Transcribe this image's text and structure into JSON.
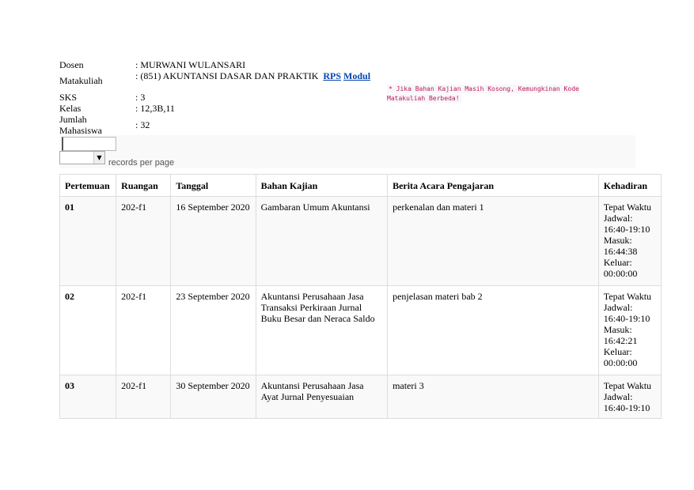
{
  "info": {
    "dosen_label": "Dosen",
    "dosen_value": ": MURWANI WULANSARI",
    "matakuliah_label": "Matakuliah",
    "matakuliah_value": ": (851) AKUNTANSI DASAR DAN PRAKTIK",
    "rps_link": "RPS",
    "modul_link": "Modul",
    "note": "* Jika Bahan Kajian Masih Kosong, Kemungkinan Kode Matakuliah Berbeda!",
    "sks_label": "SKS",
    "sks_value": ": 3",
    "kelas_label": "Kelas",
    "kelas_value": ": 12,3B,11",
    "jumlah_label_1": "Jumlah",
    "jumlah_label_2": "Mahasiswa",
    "jumlah_value": ": 32"
  },
  "controls": {
    "search_value": "",
    "per_page_value": "",
    "per_page_label": "records per page"
  },
  "table": {
    "headers": [
      "Pertemuan",
      "Ruangan",
      "Tanggal",
      "Bahan Kajian",
      "Berita Acara Pengajaran",
      "Kehadiran"
    ],
    "rows": [
      {
        "pertemuan": "01",
        "ruangan": "202-f1",
        "tanggal": "16 September 2020",
        "bahan": "Gambaran Umum Akuntansi",
        "berita": "perkenalan dan materi 1",
        "kehadiran": [
          "Tepat Waktu",
          "Jadwal:",
          "16:40-19:10",
          "Masuk:",
          "16:44:38",
          "Keluar:",
          "00:00:00"
        ]
      },
      {
        "pertemuan": "02",
        "ruangan": "202-f1",
        "tanggal": "23 September 2020",
        "bahan": "Akuntansi Perusahaan Jasa Transaksi Perkiraan Jurnal Buku Besar dan Neraca Saldo",
        "berita": "penjelasan materi bab 2",
        "kehadiran": [
          "Tepat Waktu",
          "Jadwal:",
          "16:40-19:10",
          "Masuk:",
          "16:42:21",
          "Keluar:",
          "00:00:00"
        ]
      },
      {
        "pertemuan": "03",
        "ruangan": "202-f1",
        "tanggal": "30 September 2020",
        "bahan": "Akuntansi Perusahaan Jasa Ayat Jurnal Penyesuaian",
        "berita": "materi 3",
        "kehadiran": [
          "Tepat Waktu",
          "Jadwal:",
          "16:40-19:10"
        ]
      }
    ]
  }
}
